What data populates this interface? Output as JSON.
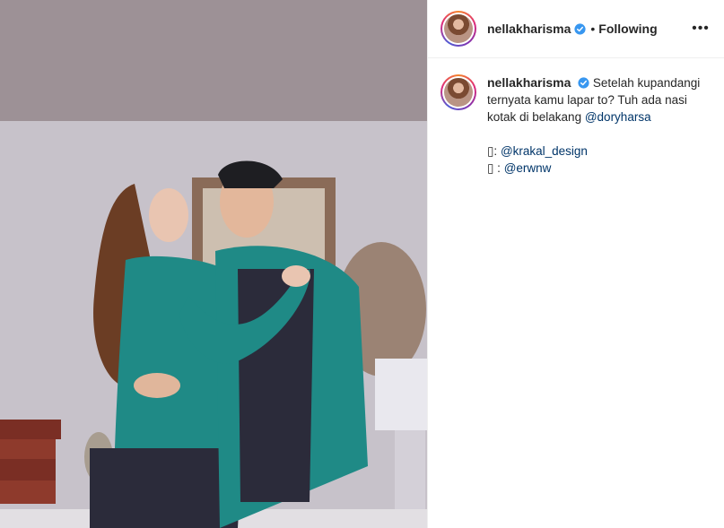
{
  "post": {
    "username": "nellakharisma",
    "follow_status": "Following",
    "separator": "•",
    "more_icon_label": "•••",
    "caption": {
      "username": "nellakharisma",
      "text": "Setelah kupandangi ternyata kamu lapar to? Tuh ada nasi kotak di belakang",
      "mention": "@doryharsa",
      "credits": [
        {
          "prefix": "▯: ",
          "handle": "@krakal_design"
        },
        {
          "prefix": "▯ : ",
          "handle": "@erwnw"
        }
      ]
    }
  },
  "colors": {
    "verified": "#3897f0",
    "mention": "#003569",
    "outfit_teal": "#1f8a86",
    "outfit_dark": "#2b2b3a"
  }
}
